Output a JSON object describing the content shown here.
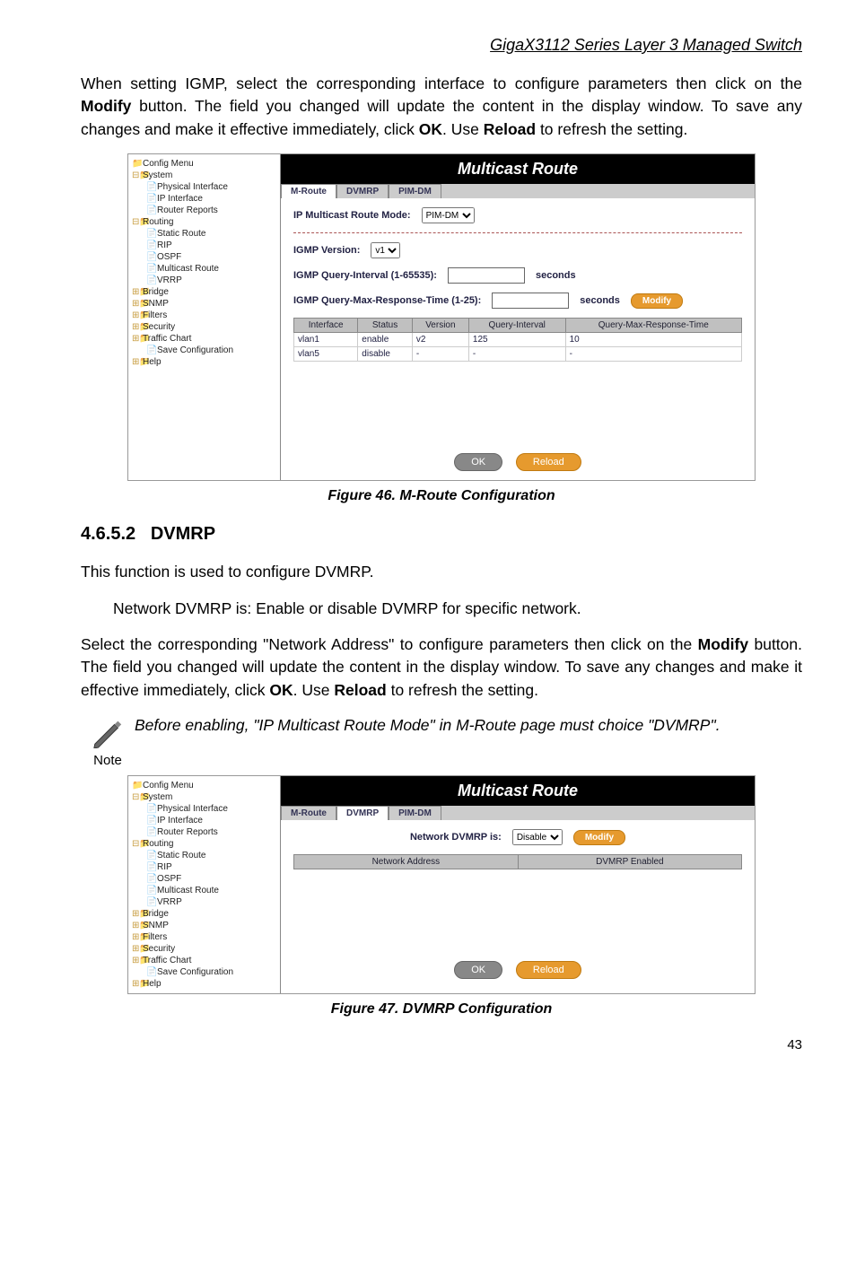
{
  "header": {
    "title": "GigaX3112 Series Layer 3 Managed Switch"
  },
  "para1": "When setting IGMP, select the corresponding interface to configure parameters then click on the ",
  "para1_b1": "Modify",
  "para1_mid": " button. The field you changed will update the content in the display window. To save any changes and make it effective immediately, click ",
  "para1_b2": "OK",
  "para1_mid2": ". Use ",
  "para1_b3": "Reload",
  "para1_end": " to refresh the setting.",
  "fig46": {
    "title": "Multicast Route",
    "tabs": [
      "M-Route",
      "DVMRP",
      "PIM-DM"
    ],
    "label_mode": "IP Multicast Route Mode:",
    "mode_value": "PIM-DM",
    "label_ver": "IGMP Version:",
    "ver_value": "v1",
    "label_qi": "IGMP Query-Interval (1-65535):",
    "qi_unit": "seconds",
    "label_qmrt": "IGMP Query-Max-Response-Time (1-25):",
    "qmrt_unit": "seconds",
    "modify": "Modify",
    "cols": [
      "Interface",
      "Status",
      "Version",
      "Query-Interval",
      "Query-Max-Response-Time"
    ],
    "rows": [
      [
        "vlan1",
        "enable",
        "v2",
        "125",
        "10"
      ],
      [
        "vlan5",
        "disable",
        "-",
        "-",
        "-"
      ]
    ],
    "ok": "OK",
    "reload": "Reload",
    "caption": "Figure 46. M-Route Configuration"
  },
  "sidebar": {
    "items": [
      "Config Menu",
      "System",
      "Physical Interface",
      "IP Interface",
      "Router Reports",
      "Routing",
      "Static Route",
      "RIP",
      "OSPF",
      "Multicast Route",
      "VRRP",
      "Bridge",
      "SNMP",
      "Filters",
      "Security",
      "Traffic Chart",
      "Save Configuration",
      "Help"
    ]
  },
  "section": {
    "num": "4.6.5.2",
    "title": "DVMRP"
  },
  "para2": "This function is used to configure DVMRP.",
  "para3": "Network DVMRP is: Enable or disable DVMRP for specific network.",
  "para4_a": "Select the corresponding \"Network Address\" to configure parameters then click on the ",
  "para4_b1": "Modify",
  "para4_b": " button. The field you changed will update the content in the display window. To save any changes and make it effective immediately, click ",
  "para4_b2": "OK",
  "para4_c": ". Use ",
  "para4_b3": "Reload",
  "para4_d": " to refresh the setting.",
  "note": {
    "label": "Note",
    "text": "Before enabling, \"IP Multicast Route Mode\" in M-Route page must choice \"DVMRP\"."
  },
  "fig47": {
    "title": "Multicast Route",
    "tabs": [
      "M-Route",
      "DVMRP",
      "PIM-DM"
    ],
    "label": "Network DVMRP is:",
    "sel": "Disable",
    "modify": "Modify",
    "cols": [
      "Network Address",
      "DVMRP Enabled"
    ],
    "ok": "OK",
    "reload": "Reload",
    "caption": "Figure 47. DVMRP Configuration"
  },
  "pagenum": "43"
}
